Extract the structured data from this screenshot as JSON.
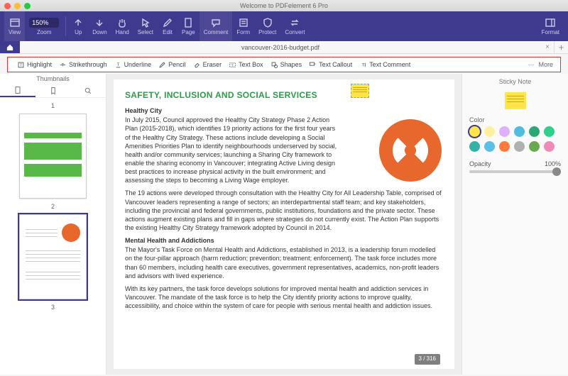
{
  "window_title": "Welcome to PDFelement 6 Pro",
  "file_tab": "vancouver-2016-budget.pdf",
  "zoom_value": "150%",
  "main_toolbar": {
    "view": "View",
    "zoom": "Zoom",
    "up": "Up",
    "down": "Down",
    "hand": "Hand",
    "select": "Select",
    "edit": "Edit",
    "page": "Page",
    "comment": "Comment",
    "form": "Form",
    "protect": "Protect",
    "convert": "Convert",
    "format": "Format"
  },
  "sub_toolbar": {
    "highlight": "Highlight",
    "strike": "Strikethrough",
    "underline": "Underline",
    "pencil": "Pencil",
    "eraser": "Eraser",
    "textbox": "Text Box",
    "shapes": "Shapes",
    "callout": "Text Callout",
    "comment": "Text Comment",
    "more": "More"
  },
  "thumbnails": {
    "title": "Thumbnails",
    "n1": "1",
    "n2": "2",
    "n3": "3"
  },
  "page_indicator": "3 / 316",
  "doc": {
    "h1": "SAFETY, INCLUSION AND SOCIAL SERVICES",
    "s1h": "Healthy City",
    "s1p1": "In July 2015, Council approved the Healthy City Strategy Phase 2 Action Plan (2015-2018), which identifies 19 priority actions for the first four years of the Healthy City Strategy. These actions include developing a Social Amenities Priorities Plan to identify neighbourhoods underserved by social, health and/or community services; launching a Sharing City framework to enable the sharing economy in Vancouver; integrating Active Living design best practices to increase physical activity in the built environment; and assessing the steps to becoming a Living Wage employer.",
    "s1p2": "The 19 actions were developed through consultation with the Healthy City for All Leadership Table, comprised of Vancouver leaders representing a range of sectors; an interdepartmental staff team; and key stakeholders, including the provincial and federal governments, public institutions, foundations and the private sector. These actions augment existing plans and fill in gaps where strategies do not currently exist. The Action Plan supports the existing Healthy City Strategy framework adopted by Council in 2014.",
    "s2h": "Mental Health and Addictions",
    "s2p1": "The Mayor's Task Force on Mental Health and Addictions, established in 2013, is a leadership forum modelled on the four-pillar approach (harm reduction; prevention; treatment; enforcement). The task force includes more than 60 members, including health care executives, government representatives, academics, non-profit leaders and advisors with lived experience.",
    "s2p2": "With its key partners, the task force develops solutions for improved mental health and addiction services in Vancouver. The mandate of the task force is to help the City identify priority actions to improve quality, accessibility, and choice within the system of care for people with serious mental health and addiction issues."
  },
  "right": {
    "title": "Sticky Note",
    "color_label": "Color",
    "opacity_label": "Opacity",
    "opacity_value": "100%",
    "colors": [
      "#ffe54a",
      "#ffef9e",
      "#e0b0ff",
      "#4fbce0",
      "#2aa876",
      "#2fd08b",
      "#33b3a6",
      "#5ac0e8",
      "#ff7a3d",
      "#b0b0b0",
      "#6aa84f",
      "#f08bb9"
    ]
  }
}
